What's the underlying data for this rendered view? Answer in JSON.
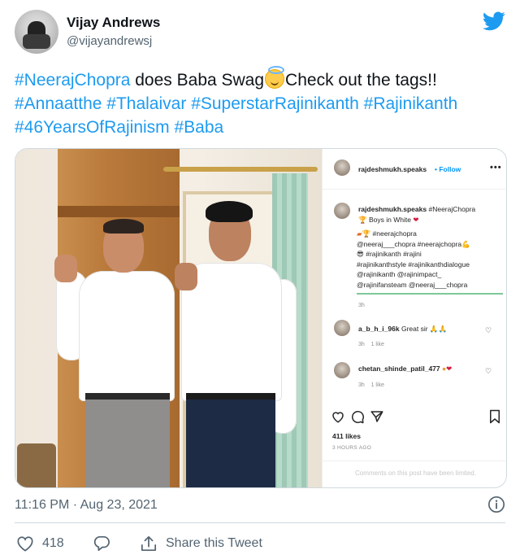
{
  "author": {
    "name": "Vijay Andrews",
    "handle": "@vijayandrewsj"
  },
  "tweet": {
    "segments": [
      {
        "text": "#NeerajChopra",
        "type": "hashtag"
      },
      {
        "text": " does Baba Swag",
        "type": "text"
      },
      {
        "text": "",
        "type": "emoji",
        "icon": "smiling-face-with-halo-emoji"
      },
      {
        "text": "Check out the tags!!",
        "type": "text"
      },
      {
        "text": "#Annaatthe",
        "type": "hashtag"
      },
      {
        "text": " ",
        "type": "text"
      },
      {
        "text": "#Thalaivar",
        "type": "hashtag"
      },
      {
        "text": " ",
        "type": "text"
      },
      {
        "text": "#SuperstarRajinikanth",
        "type": "hashtag"
      },
      {
        "text": " ",
        "type": "text"
      },
      {
        "text": "#Rajinikanth",
        "type": "hashtag"
      },
      {
        "text": "#46YearsOfRajinism",
        "type": "hashtag"
      },
      {
        "text": " ",
        "type": "text"
      },
      {
        "text": "#Baba",
        "type": "hashtag"
      }
    ],
    "timestamp": "11:16 PM · Aug 23, 2021",
    "like_count": "418",
    "share_label": "Share this Tweet"
  },
  "instagram": {
    "username": "rajdeshmukh.speaks",
    "follow_sep": "•",
    "follow_label": "Follow",
    "caption_tag": "#NeerajChopra",
    "caption_line2": "Boys in White",
    "tag_block": [
      "#neerajchopra",
      "@neeraj___chopra #neerajchopra",
      "#rajinikanth #rajini",
      "#rajinikanthstyle #rajinikanthdialogue",
      "@rajinikanth @rajinimpact_",
      "@rajinifansteam @neeraj___chopra"
    ],
    "caption_time": "3h",
    "comments": [
      {
        "user": "a_b_h_i_96k",
        "text": "Great sir",
        "time": "3h",
        "likes": "1 like"
      },
      {
        "user": "chetan_shinde_patil_477",
        "text": "",
        "time": "3h",
        "likes": "1 like"
      }
    ],
    "likes": "411 likes",
    "ago": "3 HOURS AGO",
    "limited_notice": "Comments on this post have been limited."
  },
  "colors": {
    "hashtag": "#1d9bf0",
    "twitter_blue": "#1d9bf0",
    "secondary_text": "#536471",
    "instagram_link": "#0095f6"
  }
}
